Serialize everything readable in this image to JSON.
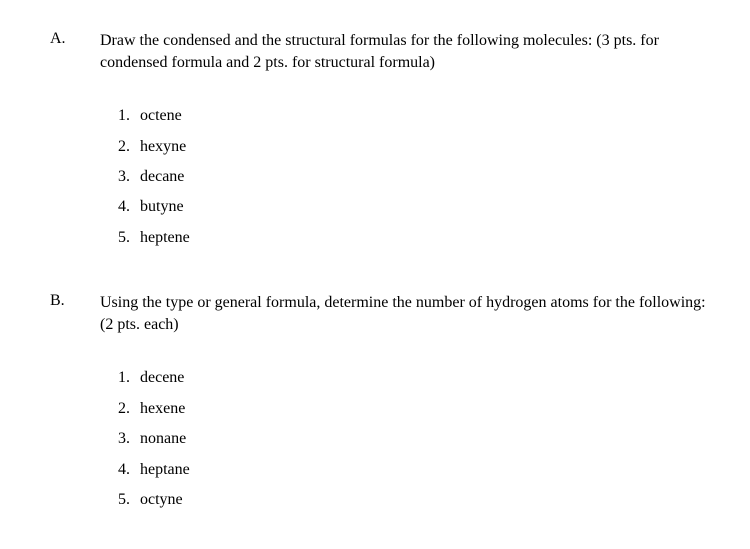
{
  "sections": [
    {
      "label": "A.",
      "prompt": "Draw the condensed and the structural formulas for the following molecules: (3 pts. for condensed formula and 2 pts. for structural formula)",
      "items": [
        {
          "num": "1.",
          "text": "octene"
        },
        {
          "num": "2.",
          "text": "hexyne"
        },
        {
          "num": "3.",
          "text": "decane"
        },
        {
          "num": "4.",
          "text": "butyne"
        },
        {
          "num": "5.",
          "text": "heptene"
        }
      ]
    },
    {
      "label": "B.",
      "prompt": "Using the type or general formula, determine the number of hydrogen atoms for the following: (2 pts. each)",
      "items": [
        {
          "num": "1.",
          "text": "decene"
        },
        {
          "num": "2.",
          "text": "hexene"
        },
        {
          "num": "3.",
          "text": "nonane"
        },
        {
          "num": "4.",
          "text": "heptane"
        },
        {
          "num": "5.",
          "text": "octyne"
        }
      ]
    }
  ]
}
